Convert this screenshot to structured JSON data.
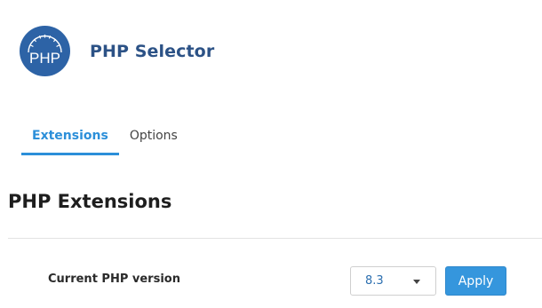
{
  "header": {
    "logo_text": "PHP",
    "title": "PHP Selector"
  },
  "tabs": [
    {
      "label": "Extensions",
      "active": true
    },
    {
      "label": "Options",
      "active": false
    }
  ],
  "section": {
    "title": "PHP Extensions"
  },
  "version_row": {
    "label": "Current PHP version",
    "selected_version": "8.3",
    "apply_label": "Apply"
  },
  "colors": {
    "accent": "#2c8fd9",
    "logo_bg": "#2d63a6",
    "title_color": "#2c5286",
    "button_bg": "#3596dd"
  }
}
